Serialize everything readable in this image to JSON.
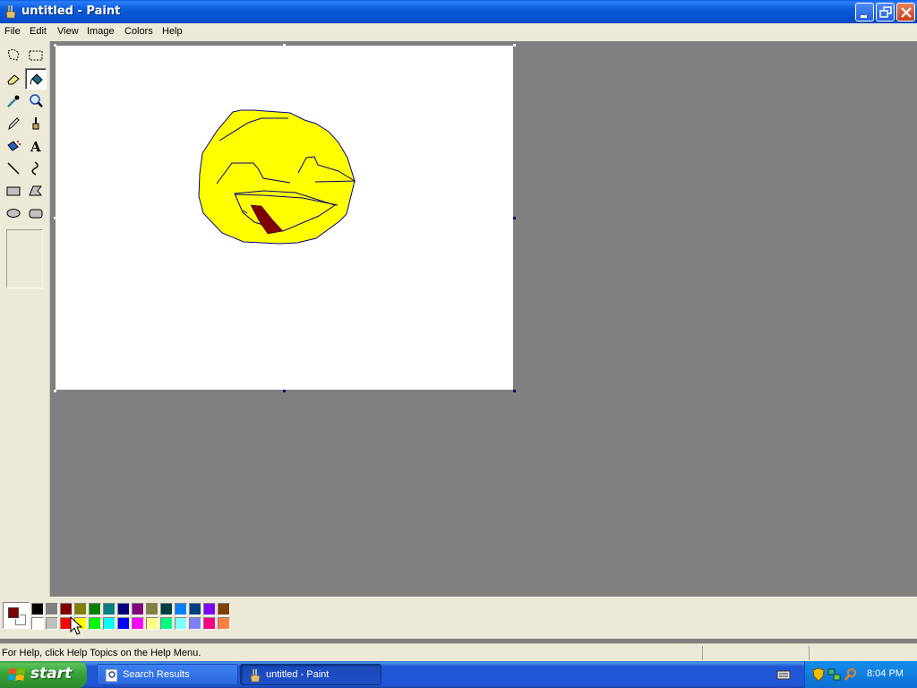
{
  "window": {
    "title": "untitled - Paint"
  },
  "menu": [
    "File",
    "Edit",
    "View",
    "Image",
    "Colors",
    "Help"
  ],
  "tools": [
    {
      "name": "free-select-icon"
    },
    {
      "name": "rect-select-icon"
    },
    {
      "name": "eraser-icon"
    },
    {
      "name": "fill-bucket-icon",
      "selected": true
    },
    {
      "name": "color-picker-icon"
    },
    {
      "name": "magnifier-icon"
    },
    {
      "name": "pencil-icon"
    },
    {
      "name": "brush-icon"
    },
    {
      "name": "airbrush-icon"
    },
    {
      "name": "text-icon",
      "label": "A"
    },
    {
      "name": "line-icon"
    },
    {
      "name": "curve-icon"
    },
    {
      "name": "rectangle-icon"
    },
    {
      "name": "polygon-icon"
    },
    {
      "name": "ellipse-icon"
    },
    {
      "name": "rounded-rect-icon"
    }
  ],
  "colors": {
    "foreground": "#800000",
    "background": "#ffffff",
    "palette_top": [
      "#000000",
      "#808080",
      "#800000",
      "#808000",
      "#008000",
      "#008080",
      "#000080",
      "#800080",
      "#808040",
      "#004040",
      "#0080ff",
      "#004080",
      "#8000ff",
      "#804000"
    ],
    "palette_bottom": [
      "#ffffff",
      "#c0c0c0",
      "#ff0000",
      "#ffff00",
      "#00ff00",
      "#00ffff",
      "#0000ff",
      "#ff00ff",
      "#ffff80",
      "#00ff80",
      "#80ffff",
      "#8080ff",
      "#ff0080",
      "#ff8040"
    ]
  },
  "drawing": {
    "face_color": "#ffff00",
    "outline_color": "#000080",
    "mouth_color": "#800000"
  },
  "status": {
    "help_text": "For Help, click Help Topics on the Help Menu."
  },
  "taskbar": {
    "start_label": "start",
    "buttons": [
      {
        "label": "Search Results",
        "active": false
      },
      {
        "label": "untitled - Paint",
        "active": true
      }
    ],
    "clock": "8:04 PM"
  }
}
